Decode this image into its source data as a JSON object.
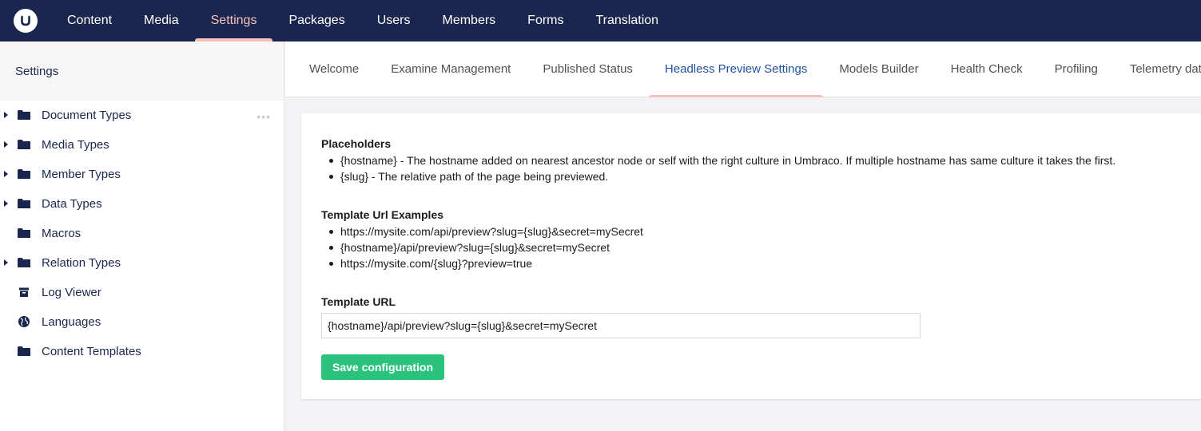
{
  "app": {
    "logo_icon": "umbraco-logo-icon",
    "colors": {
      "topbar": "#1b264f",
      "active_nav": "#f5c1bc",
      "active_tab": "#2152a3",
      "save_button": "#2bc37c"
    }
  },
  "topnav": {
    "items": [
      {
        "label": "Content"
      },
      {
        "label": "Media"
      },
      {
        "label": "Settings",
        "active": true
      },
      {
        "label": "Packages"
      },
      {
        "label": "Users"
      },
      {
        "label": "Members"
      },
      {
        "label": "Forms"
      },
      {
        "label": "Translation"
      }
    ]
  },
  "sidebar": {
    "title": "Settings",
    "more_icon": "ellipsis-icon",
    "items": [
      {
        "label": "Document Types",
        "icon": "folder-icon",
        "expandable": true
      },
      {
        "label": "Media Types",
        "icon": "folder-icon",
        "expandable": true
      },
      {
        "label": "Member Types",
        "icon": "folder-icon",
        "expandable": true
      },
      {
        "label": "Data Types",
        "icon": "folder-icon",
        "expandable": true
      },
      {
        "label": "Macros",
        "icon": "folder-icon",
        "expandable": false
      },
      {
        "label": "Relation Types",
        "icon": "folder-icon",
        "expandable": true
      },
      {
        "label": "Log Viewer",
        "icon": "box-icon",
        "expandable": false
      },
      {
        "label": "Languages",
        "icon": "globe-icon",
        "expandable": false
      },
      {
        "label": "Content Templates",
        "icon": "folder-icon",
        "expandable": false
      }
    ]
  },
  "tabs": {
    "items": [
      {
        "label": "Welcome"
      },
      {
        "label": "Examine Management"
      },
      {
        "label": "Published Status"
      },
      {
        "label": "Headless Preview Settings",
        "active": true
      },
      {
        "label": "Models Builder"
      },
      {
        "label": "Health Check"
      },
      {
        "label": "Profiling"
      },
      {
        "label": "Telemetry data"
      }
    ]
  },
  "content": {
    "placeholders": {
      "title": "Placeholders",
      "items": [
        "{hostname} - The hostname added on nearest ancestor node or self with the right culture in Umbraco. If multiple hostname has same culture it takes the first.",
        "{slug} - The relative path of the page being previewed."
      ]
    },
    "examples": {
      "title": "Template Url Examples",
      "items": [
        "https://mysite.com/api/preview?slug={slug}&secret=mySecret",
        "{hostname}/api/preview?slug={slug}&secret=mySecret",
        "https://mysite.com/{slug}?preview=true"
      ]
    },
    "template_url": {
      "label": "Template URL",
      "value": "{hostname}/api/preview?slug={slug}&secret=mySecret"
    },
    "save_label": "Save configuration"
  }
}
